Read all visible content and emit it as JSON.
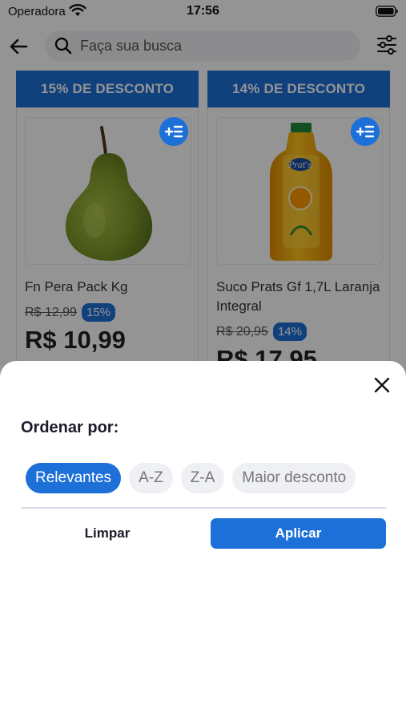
{
  "status_bar": {
    "carrier": "Operadora",
    "time": "17:56"
  },
  "header": {
    "search_placeholder": "Faça sua busca",
    "icons": [
      "back-arrow-icon",
      "search-icon",
      "filter-sliders-icon"
    ]
  },
  "products": [
    {
      "banner": "15% DE DESCONTO",
      "name": "Fn Pera Pack Kg",
      "old_price": "R$ 12,99",
      "discount": "15%",
      "price": "R$ 10,99",
      "image": "pear-image"
    },
    {
      "banner": "14% DE DESCONTO",
      "name": "Suco Prats Gf 1,7L Laranja Integral",
      "old_price": "R$ 20,95",
      "discount": "14%",
      "price": "R$ 17,95",
      "image": "orange-juice-bottle-image",
      "image_label": "Prat's"
    }
  ],
  "sort_sheet": {
    "title": "Ordenar por:",
    "options": [
      "Relevantes",
      "A-Z",
      "Z-A",
      "Maior desconto"
    ],
    "selected": "Relevantes",
    "clear_label": "Limpar",
    "apply_label": "Aplicar"
  },
  "colors": {
    "primary": "#1d70d8",
    "chip_background": "#eef0f4",
    "overlay": "rgba(0,0,0,0.42)"
  }
}
